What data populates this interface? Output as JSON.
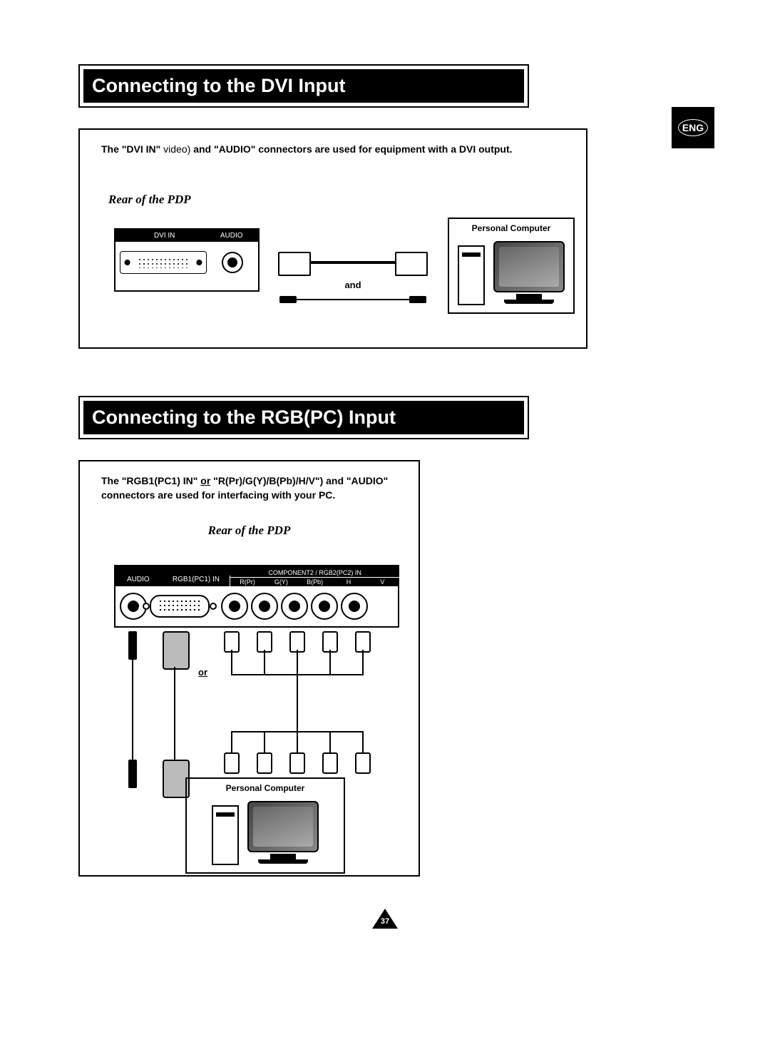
{
  "lang_badge": "ENG",
  "section1": {
    "title": "Connecting to the DVI Input",
    "intro_strong1": "The \"DVI IN\"",
    "intro_light": " video) ",
    "intro_strong2": "and \"AUDIO\" connectors are used for equipment with a DVI output.",
    "subhead": "Rear of the PDP",
    "dvi_label": "DVI IN",
    "audio_label": "AUDIO",
    "and_label": "and",
    "pc_title": "Personal Computer"
  },
  "section2": {
    "title": "Connecting to the RGB(PC) Input",
    "intro_prefix": "The \"RGB1(PC1) IN\" ",
    "intro_or": "or",
    "intro_rest": " \"R(Pr)/G(Y)/B(Pb)/H/V\") and \"AUDIO\" connectors are used for interfacing with your PC.",
    "subhead": "Rear of the PDP",
    "labels": {
      "audio": "AUDIO",
      "rgb1": "RGB1(PC1) IN",
      "comp_title": "COMPONENT2 / RGB2(PC2) IN",
      "rpr": "R(Pr)",
      "gy": "G(Y)",
      "bpb": "B(Pb)",
      "h": "H",
      "v": "V"
    },
    "or_label": "or",
    "pc_title": "Personal Computer"
  },
  "page_number": "37"
}
